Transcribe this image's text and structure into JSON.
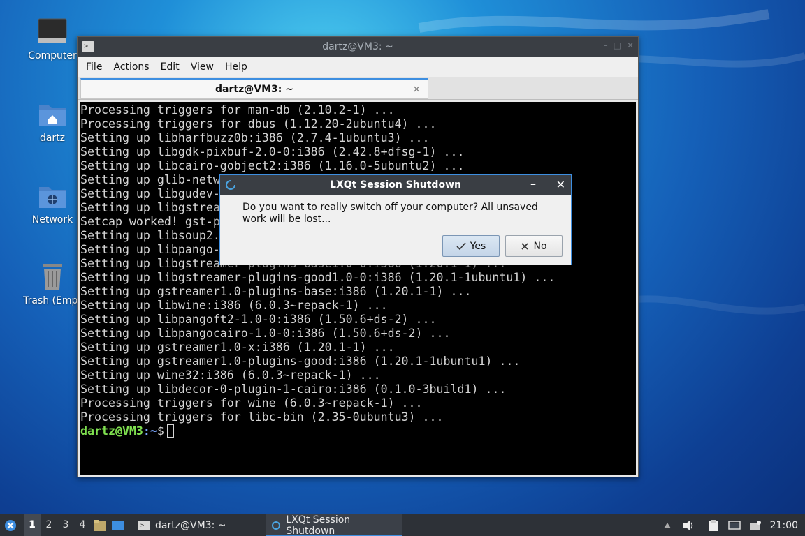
{
  "desktop": {
    "icons": [
      {
        "label": "Computer"
      },
      {
        "label": "dartz"
      },
      {
        "label": "Network"
      },
      {
        "label": "Trash (Empt"
      }
    ]
  },
  "terminal": {
    "title": "dartz@VM3: ~",
    "menu": [
      "File",
      "Actions",
      "Edit",
      "View",
      "Help"
    ],
    "tab_label": "dartz@VM3: ~",
    "tab_close": "×",
    "lines": [
      "Processing triggers for man-db (2.10.2-1) ...",
      "Processing triggers for dbus (1.12.20-2ubuntu4) ...",
      "Setting up libharfbuzz0b:i386 (2.7.4-1ubuntu3) ...",
      "Setting up libgdk-pixbuf-2.0-0:i386 (2.42.8+dfsg-1) ...",
      "Setting up libcairo-gobject2:i386 (1.16.0-5ubuntu2) ...",
      "Setting up glib-netw",
      "Setting up libgudev-",
      "Setting up libgstrea",
      "Setcap worked! gst-p",
      "Setting up libsoup2.",
      "Setting up libpango-",
      "Setting up libgstreamer-plugins-base1.0-0:i386 (1.20.1-1) ...",
      "Setting up libgstreamer-plugins-good1.0-0:i386 (1.20.1-1ubuntu1) ...",
      "Setting up gstreamer1.0-plugins-base:i386 (1.20.1-1) ...",
      "Setting up libwine:i386 (6.0.3~repack-1) ...",
      "Setting up libpangoft2-1.0-0:i386 (1.50.6+ds-2) ...",
      "Setting up libpangocairo-1.0-0:i386 (1.50.6+ds-2) ...",
      "Setting up gstreamer1.0-x:i386 (1.20.1-1) ...",
      "Setting up gstreamer1.0-plugins-good:i386 (1.20.1-1ubuntu1) ...",
      "Setting up wine32:i386 (6.0.3~repack-1) ...",
      "Setting up libdecor-0-plugin-1-cairo:i386 (0.1.0-3build1) ...",
      "Processing triggers for wine (6.0.3~repack-1) ...",
      "Processing triggers for libc-bin (2.35-0ubuntu3) ..."
    ],
    "prompt_user": "dartz@VM3",
    "prompt_path": ":~",
    "prompt_symbol": "$"
  },
  "dialog": {
    "title": "LXQt Session Shutdown",
    "message": "Do you want to really switch off your computer? All unsaved work will be lost...",
    "yes_label": "Yes",
    "no_label": "No",
    "minimize": "–",
    "close": "✕"
  },
  "taskbar": {
    "workspaces": [
      "1",
      "2",
      "3",
      "4"
    ],
    "active_workspace": "1",
    "tasks": [
      {
        "label": "dartz@VM3: ~"
      },
      {
        "label": "LXQt Session Shutdown"
      }
    ],
    "clock": "21:00"
  },
  "colors": {
    "accent": "#3d8ee0",
    "prompt_user": "#7fe04f",
    "prompt_path": "#7aa6ff"
  }
}
